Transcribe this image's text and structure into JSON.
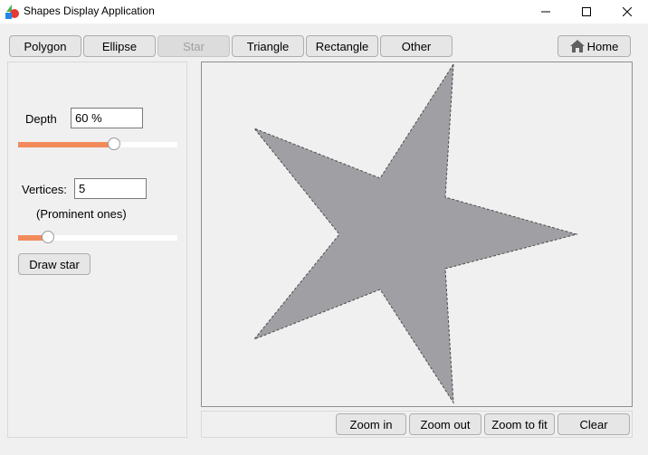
{
  "window": {
    "title": "Shapes Display Application"
  },
  "toolbar": {
    "tabs": [
      {
        "label": "Polygon",
        "enabled": true
      },
      {
        "label": "Ellipse",
        "enabled": true
      },
      {
        "label": "Star",
        "enabled": false
      },
      {
        "label": "Triangle",
        "enabled": true
      },
      {
        "label": "Rectangle",
        "enabled": true
      },
      {
        "label": "Other",
        "enabled": true
      }
    ],
    "home_label": "Home",
    "home_icon": "home-icon"
  },
  "sidebar": {
    "depth_label": "Depth",
    "depth_value": "60 %",
    "depth_slider_fraction": 0.6,
    "vertices_label": "Vertices:",
    "vertices_value": "5",
    "vertices_hint": "(Prominent ones)",
    "vertices_slider_fraction": 0.19,
    "draw_button_label": "Draw star"
  },
  "canvas": {
    "shape": "star",
    "points": 5,
    "fill_color": "#a09fa3",
    "outline_color": "#4d4d4d"
  },
  "footer": {
    "zoom_in_label": "Zoom in",
    "zoom_out_label": "Zoom out",
    "zoom_fit_label": "Zoom to fit",
    "clear_label": "Clear"
  },
  "colors": {
    "accent": "#f28b5b",
    "background": "#f0f0f0"
  }
}
